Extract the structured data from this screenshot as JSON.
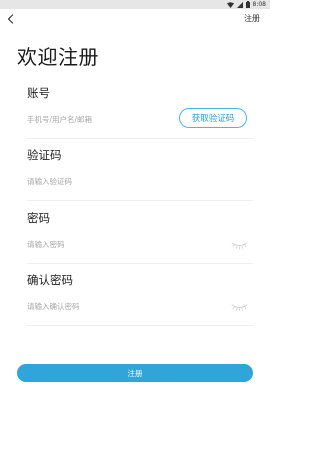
{
  "status_bar": {
    "time": "8:08"
  },
  "nav": {
    "back_icon": "chevron-left-icon",
    "register_label": "注册"
  },
  "title": "欢迎注册",
  "fields": {
    "account": {
      "label": "账号",
      "placeholder": "手机号/用户名/邮箱",
      "value": ""
    },
    "code": {
      "label": "验证码",
      "placeholder": "请输入验证码",
      "value": ""
    },
    "password": {
      "label": "密码",
      "placeholder": "请输入密码",
      "value": "",
      "toggle_icon": "eye-closed-icon"
    },
    "confirm": {
      "label": "确认密码",
      "placeholder": "请输入确认密码",
      "value": "",
      "toggle_icon": "eye-closed-icon"
    }
  },
  "get_code_label": "获取验证码",
  "submit_label": "注册",
  "colors": {
    "accent": "#30a5d9",
    "code_button_border": "#4fb4dd",
    "status_bar": "#e6e6e6"
  }
}
